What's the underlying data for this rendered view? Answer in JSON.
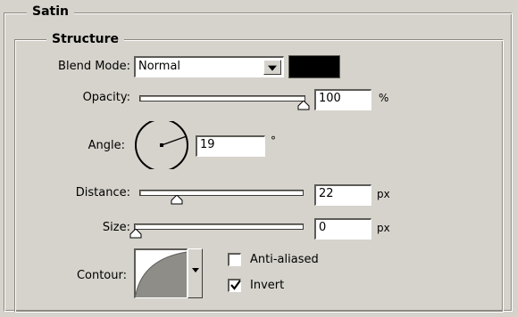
{
  "panel": {
    "outer_title": "Satin",
    "inner_title": "Structure"
  },
  "blend_mode": {
    "label": "Blend Mode:",
    "value": "Normal",
    "color": "#000000"
  },
  "opacity": {
    "label": "Opacity:",
    "value": "100",
    "unit": "%",
    "level": 1.0
  },
  "angle": {
    "label": "Angle:",
    "value": "19",
    "unit": "°"
  },
  "distance": {
    "label": "Distance:",
    "value": "22",
    "unit": "px",
    "level": 0.22
  },
  "size": {
    "label": "Size:",
    "value": "0",
    "unit": "px",
    "level": 0.0
  },
  "contour": {
    "label": "Contour:",
    "icon": "contour-curve-icon"
  },
  "anti_aliased": {
    "label": "Anti-aliased",
    "checked": false
  },
  "invert": {
    "label": "Invert",
    "checked": true
  }
}
